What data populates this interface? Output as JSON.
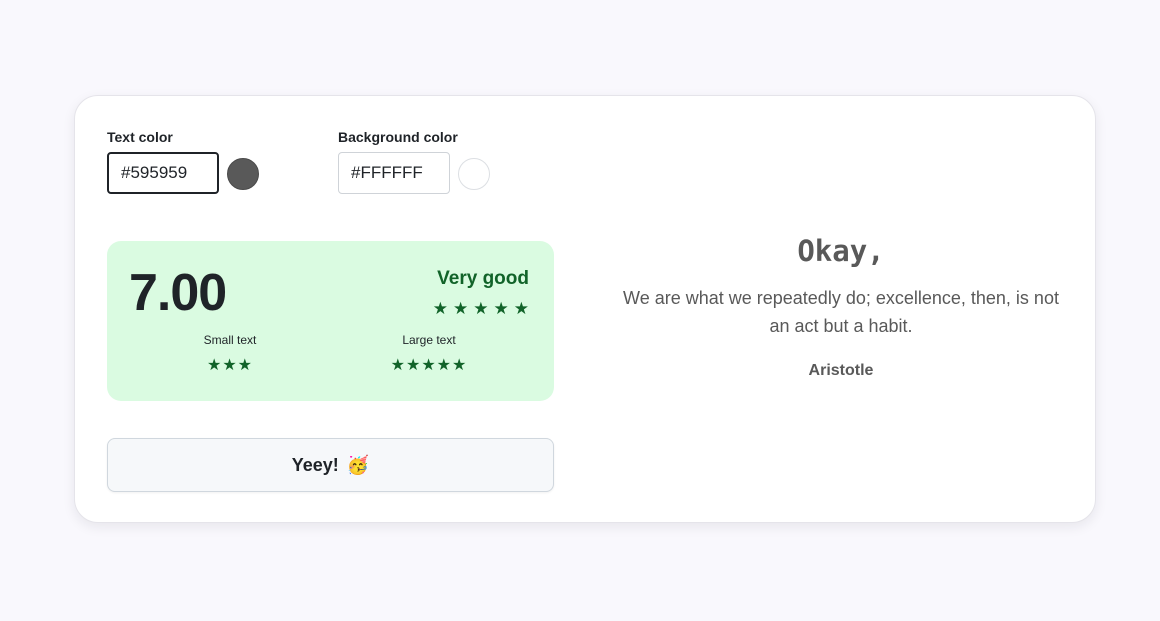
{
  "text_color": {
    "label": "Text color",
    "value": "#595959",
    "swatch": "#595959"
  },
  "background_color": {
    "label": "Background color",
    "value": "#FFFFFF",
    "swatch": "#FFFFFF"
  },
  "score": {
    "value": "7.00",
    "rating": "Very good",
    "rating_stars": "★★★★★",
    "small_text": {
      "label": "Small text",
      "stars": "★★★"
    },
    "large_text": {
      "label": "Large text",
      "stars": "★★★★★"
    },
    "panel_color": "#dafbe1",
    "accent_color": "#116329"
  },
  "action": {
    "label": "Yeey!",
    "emoji": "🥳"
  },
  "preview": {
    "heading": "Okay,",
    "quote": "We are what we repeatedly do; excellence, then, is not an act but a habit.",
    "author": "Aristotle"
  }
}
